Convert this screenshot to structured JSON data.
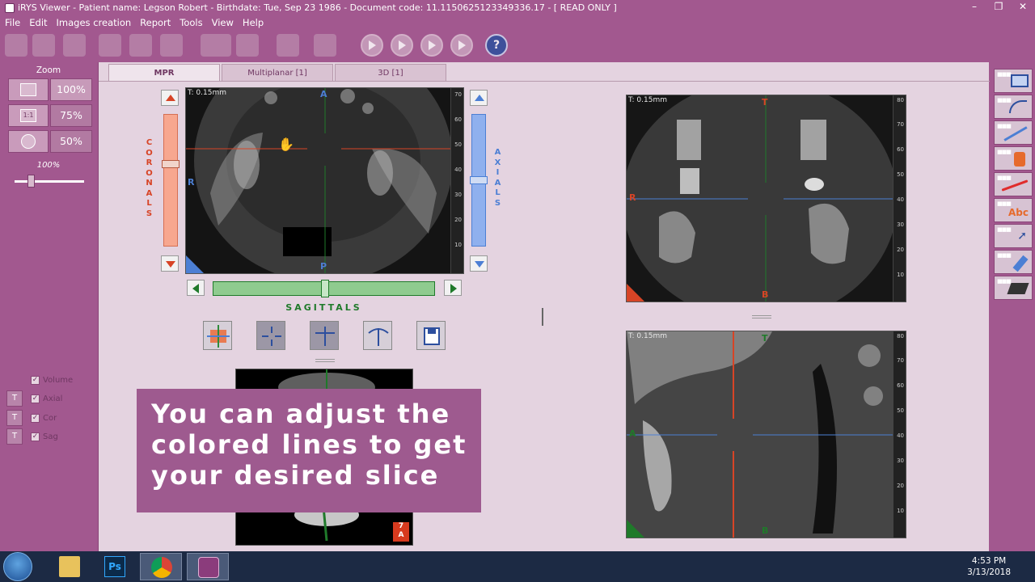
{
  "window": {
    "title": "iRYS Viewer - Patient name: Legson Robert - Birthdate: Tue, Sep 23 1986 - Document code: 11.1150625123349336.17  -  [ READ ONLY ]"
  },
  "menu": [
    "File",
    "Edit",
    "Images creation",
    "Report",
    "Tools",
    "View",
    "Help"
  ],
  "help_icon_label": "?",
  "zoom": {
    "title": "Zoom",
    "levels": [
      "100%",
      "75%",
      "50%"
    ],
    "current": "100%",
    "fit_label": "1:1"
  },
  "visibility": {
    "items": [
      {
        "label": "Volume",
        "checked": true,
        "has_t_button": false
      },
      {
        "label": "Axial",
        "checked": true,
        "has_t_button": true
      },
      {
        "label": "Cor",
        "checked": true,
        "has_t_button": true
      },
      {
        "label": "Sag",
        "checked": true,
        "has_t_button": true
      }
    ],
    "t_label": "T"
  },
  "tabs": [
    {
      "label": "MPR",
      "active": true
    },
    {
      "label": "Multiplanar [1]",
      "active": false
    },
    {
      "label": "3D [1]",
      "active": false
    }
  ],
  "views": {
    "axial": {
      "thickness": "T: 0.15mm",
      "top": "A",
      "bottom": "P",
      "left": "R"
    },
    "coronal": {
      "thickness": "T: 0.15mm",
      "top": "T",
      "bottom": "B",
      "left": "R"
    },
    "sagittal": {
      "thickness": "T: 0.15mm",
      "top": "T",
      "bottom": "B",
      "left": "A"
    },
    "volume_corner_top": "7",
    "volume_corner_bottom": "A"
  },
  "sliders": {
    "coronals": "CORONALS",
    "axials": "AXIALS",
    "sagittals": "SAGITTALS"
  },
  "ruler_ticks_axial": [
    "70",
    "60",
    "50",
    "40",
    "30",
    "20",
    "10"
  ],
  "ruler_ticks_right": [
    "80",
    "70",
    "60",
    "50",
    "40",
    "30",
    "20",
    "10"
  ],
  "caption": {
    "lines": [
      "You can adjust the",
      "colored lines to get",
      "your desired slice"
    ]
  },
  "taskbar": {
    "time": "4:53 PM",
    "date": "3/13/2018",
    "ps_label": "Ps"
  },
  "colors": {
    "chrome": "#a2588f",
    "coronal": "#d74426",
    "axial": "#4c7fd4",
    "sagittal": "#1f7a2a"
  }
}
